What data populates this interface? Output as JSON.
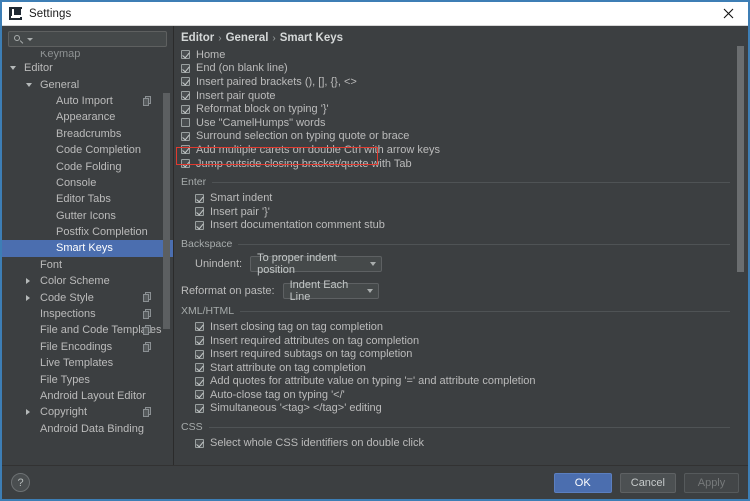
{
  "window": {
    "title": "Settings",
    "app_icon": "intellij-icon",
    "close_label": "×",
    "border_color": "#3d7eb5"
  },
  "search": {
    "value": "",
    "placeholder": "",
    "icon": "search-icon"
  },
  "sidebar": {
    "items": [
      {
        "label": "Keymap",
        "depth": 1,
        "arrow": "none",
        "clipped": true,
        "selected": false,
        "copy": false
      },
      {
        "label": "Editor",
        "depth": 0,
        "arrow": "down",
        "clipped": false,
        "selected": false,
        "copy": false
      },
      {
        "label": "General",
        "depth": 1,
        "arrow": "down",
        "clipped": false,
        "selected": false,
        "copy": false
      },
      {
        "label": "Auto Import",
        "depth": 2,
        "arrow": "none",
        "clipped": false,
        "selected": false,
        "copy": true
      },
      {
        "label": "Appearance",
        "depth": 2,
        "arrow": "none",
        "clipped": false,
        "selected": false,
        "copy": false
      },
      {
        "label": "Breadcrumbs",
        "depth": 2,
        "arrow": "none",
        "clipped": false,
        "selected": false,
        "copy": false
      },
      {
        "label": "Code Completion",
        "depth": 2,
        "arrow": "none",
        "clipped": false,
        "selected": false,
        "copy": false
      },
      {
        "label": "Code Folding",
        "depth": 2,
        "arrow": "none",
        "clipped": false,
        "selected": false,
        "copy": false
      },
      {
        "label": "Console",
        "depth": 2,
        "arrow": "none",
        "clipped": false,
        "selected": false,
        "copy": false
      },
      {
        "label": "Editor Tabs",
        "depth": 2,
        "arrow": "none",
        "clipped": false,
        "selected": false,
        "copy": false
      },
      {
        "label": "Gutter Icons",
        "depth": 2,
        "arrow": "none",
        "clipped": false,
        "selected": false,
        "copy": false
      },
      {
        "label": "Postfix Completion",
        "depth": 2,
        "arrow": "none",
        "clipped": false,
        "selected": false,
        "copy": false
      },
      {
        "label": "Smart Keys",
        "depth": 2,
        "arrow": "none",
        "clipped": false,
        "selected": true,
        "copy": false
      },
      {
        "label": "Font",
        "depth": 1,
        "arrow": "none",
        "clipped": false,
        "selected": false,
        "copy": false
      },
      {
        "label": "Color Scheme",
        "depth": 1,
        "arrow": "right",
        "clipped": false,
        "selected": false,
        "copy": false
      },
      {
        "label": "Code Style",
        "depth": 1,
        "arrow": "right",
        "clipped": false,
        "selected": false,
        "copy": true
      },
      {
        "label": "Inspections",
        "depth": 1,
        "arrow": "none",
        "clipped": false,
        "selected": false,
        "copy": true
      },
      {
        "label": "File and Code Templates",
        "depth": 1,
        "arrow": "none",
        "clipped": false,
        "selected": false,
        "copy": true
      },
      {
        "label": "File Encodings",
        "depth": 1,
        "arrow": "none",
        "clipped": false,
        "selected": false,
        "copy": true
      },
      {
        "label": "Live Templates",
        "depth": 1,
        "arrow": "none",
        "clipped": false,
        "selected": false,
        "copy": false
      },
      {
        "label": "File Types",
        "depth": 1,
        "arrow": "none",
        "clipped": false,
        "selected": false,
        "copy": false
      },
      {
        "label": "Android Layout Editor",
        "depth": 1,
        "arrow": "none",
        "clipped": false,
        "selected": false,
        "copy": false
      },
      {
        "label": "Copyright",
        "depth": 1,
        "arrow": "right",
        "clipped": false,
        "selected": false,
        "copy": true
      },
      {
        "label": "Android Data Binding",
        "depth": 1,
        "arrow": "none",
        "clipped": false,
        "selected": false,
        "copy": false
      }
    ],
    "selection_color": "#4b6eaf"
  },
  "breadcrumb": {
    "parts": [
      "Editor",
      "General",
      "Smart Keys"
    ],
    "separator": "›"
  },
  "main": {
    "top_options": [
      {
        "label": "Home",
        "checked": true
      },
      {
        "label": "End (on blank line)",
        "checked": true
      },
      {
        "label": "Insert paired brackets (), [], {}, <>",
        "checked": true
      },
      {
        "label": "Insert pair quote",
        "checked": true
      },
      {
        "label": "Reformat block on typing '}'",
        "checked": true
      },
      {
        "label": "Use \"CamelHumps\" words",
        "checked": false
      },
      {
        "label": "Surround selection on typing quote or brace",
        "checked": true
      },
      {
        "label": "Add multiple carets on double Ctrl with arrow keys",
        "checked": true
      },
      {
        "label": "Jump outside closing bracket/quote with Tab",
        "checked": true
      }
    ],
    "highlight": {
      "target_label": "Jump outside closing bracket/quote with Tab",
      "color": "#e03a2f"
    },
    "groups": [
      {
        "title": "Enter",
        "options": [
          {
            "label": "Smart indent",
            "checked": true
          },
          {
            "label": "Insert pair '}'",
            "checked": true
          },
          {
            "label": "Insert documentation comment stub",
            "checked": true
          }
        ]
      },
      {
        "title": "Backspace",
        "options": []
      },
      {
        "title": "XML/HTML",
        "options": [
          {
            "label": "Insert closing tag on tag completion",
            "checked": true
          },
          {
            "label": "Insert required attributes on tag completion",
            "checked": true
          },
          {
            "label": "Insert required subtags on tag completion",
            "checked": true
          },
          {
            "label": "Start attribute on tag completion",
            "checked": true
          },
          {
            "label": "Add quotes for attribute value on typing '=' and attribute completion",
            "checked": true
          },
          {
            "label": "Auto-close tag on typing '</'",
            "checked": true
          },
          {
            "label": "Simultaneous '<tag> </tag>' editing",
            "checked": true
          }
        ]
      },
      {
        "title": "CSS",
        "options": [
          {
            "label": "Select whole CSS identifiers on double click",
            "checked": true
          }
        ]
      }
    ],
    "unindent": {
      "label": "Unindent:",
      "value": "To proper indent position"
    },
    "reformat_on_paste": {
      "label": "Reformat on paste:",
      "value": "Indent Each Line"
    }
  },
  "footer": {
    "help_label": "?",
    "ok_label": "OK",
    "cancel_label": "Cancel",
    "apply_label": "Apply",
    "apply_disabled": true,
    "ok_color": "#4b6eaf"
  }
}
